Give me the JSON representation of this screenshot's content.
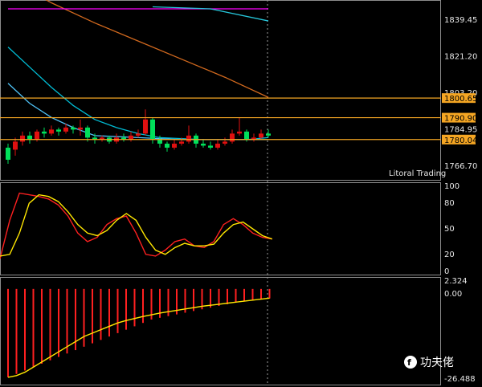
{
  "price_panel": {
    "axis_labels": [
      "1839.45",
      "1821.20",
      "1803.20",
      "1784.95",
      "1766.70"
    ],
    "axis_values": [
      1839.45,
      1821.2,
      1803.2,
      1784.95,
      1766.7
    ],
    "brand": "Litoral Trading",
    "levels": [
      {
        "label": "1800.65",
        "value": 1800.65,
        "color": "#f5a623"
      },
      {
        "label": "1790.90",
        "value": 1790.9,
        "color": "#f5a623"
      },
      {
        "label": "1780.04",
        "value": 1780.04,
        "color": "#f5a623"
      }
    ],
    "candles": [
      [
        1776,
        1770,
        1778,
        1768
      ],
      [
        1775,
        1779,
        1781,
        1772
      ],
      [
        1779,
        1782,
        1784,
        1777
      ],
      [
        1782,
        1780,
        1784,
        1778
      ],
      [
        1780,
        1784,
        1785,
        1779
      ],
      [
        1784,
        1783,
        1786,
        1781
      ],
      [
        1783,
        1785,
        1787,
        1782
      ],
      [
        1785,
        1784,
        1786,
        1782
      ],
      [
        1784,
        1786,
        1788,
        1783
      ],
      [
        1786,
        1785,
        1787,
        1783
      ],
      [
        1785,
        1786,
        1790,
        1782
      ],
      [
        1786,
        1781,
        1787,
        1779
      ],
      [
        1781,
        1780,
        1783,
        1778
      ],
      [
        1780,
        1781,
        1782,
        1779
      ],
      [
        1781,
        1779,
        1782,
        1778
      ],
      [
        1779,
        1781,
        1783,
        1778
      ],
      [
        1781,
        1780,
        1783,
        1779
      ],
      [
        1780,
        1782,
        1784,
        1779
      ],
      [
        1782,
        1783,
        1785,
        1781
      ],
      [
        1783,
        1790,
        1795,
        1782
      ],
      [
        1790,
        1780,
        1791,
        1778
      ],
      [
        1780,
        1778,
        1782,
        1776
      ],
      [
        1778,
        1776,
        1779,
        1774
      ],
      [
        1776,
        1778,
        1780,
        1775
      ],
      [
        1778,
        1779,
        1781,
        1777
      ],
      [
        1779,
        1782,
        1787,
        1778
      ],
      [
        1782,
        1778,
        1783,
        1776
      ],
      [
        1778,
        1777,
        1780,
        1776
      ],
      [
        1777,
        1776,
        1779,
        1775
      ],
      [
        1776,
        1778,
        1780,
        1775
      ],
      [
        1778,
        1779,
        1781,
        1777
      ],
      [
        1779,
        1783,
        1785,
        1778
      ],
      [
        1783,
        1784,
        1791,
        1782
      ],
      [
        1784,
        1780,
        1785,
        1779
      ],
      [
        1780,
        1781,
        1783,
        1779
      ],
      [
        1781,
        1783,
        1785,
        1780
      ],
      [
        1783,
        1782,
        1785,
        1781
      ]
    ],
    "candle_colors": {
      "up": "#e01010",
      "down": "#00e05a"
    },
    "moving_averages": [
      {
        "color": "#d2691e",
        "points": [
          [
            0,
            1860
          ],
          [
            6,
            1848
          ],
          [
            12,
            1838
          ],
          [
            18,
            1829
          ],
          [
            24,
            1820
          ],
          [
            30,
            1811
          ],
          [
            36,
            1801
          ]
        ]
      },
      {
        "color": "#00bcd4",
        "points": [
          [
            0,
            1826
          ],
          [
            3,
            1816
          ],
          [
            6,
            1806
          ],
          [
            9,
            1797
          ],
          [
            12,
            1790
          ],
          [
            15,
            1786
          ],
          [
            18,
            1783
          ],
          [
            21,
            1781
          ],
          [
            27,
            1780
          ],
          [
            33,
            1780
          ],
          [
            36,
            1781
          ]
        ]
      },
      {
        "color": "#4fc3f7",
        "points": [
          [
            0,
            1808
          ],
          [
            3,
            1798
          ],
          [
            6,
            1791
          ],
          [
            9,
            1786
          ],
          [
            12,
            1782
          ],
          [
            18,
            1781
          ],
          [
            24,
            1780
          ],
          [
            30,
            1780
          ],
          [
            36,
            1780
          ]
        ]
      },
      {
        "color": "#ff00ff",
        "points": [
          [
            0,
            1845
          ],
          [
            18,
            1845
          ],
          [
            36,
            1845
          ]
        ]
      },
      {
        "color": "#26c6da",
        "points": [
          [
            20,
            1846
          ],
          [
            28,
            1845
          ],
          [
            36,
            1839
          ]
        ]
      }
    ]
  },
  "stoch_panel": {
    "axis_labels": [
      "100",
      "80",
      "50",
      "20",
      "0"
    ],
    "axis_values": [
      100,
      80,
      50,
      20,
      0
    ],
    "main_line": {
      "color": "#ff2020",
      "values": [
        15,
        60,
        92,
        90,
        88,
        85,
        78,
        65,
        45,
        35,
        40,
        55,
        62,
        65,
        45,
        20,
        18,
        25,
        35,
        38,
        30,
        28,
        35,
        55,
        62,
        55,
        45,
        40,
        38
      ]
    },
    "signal_line": {
      "color": "#ffe600",
      "values": [
        18,
        20,
        45,
        80,
        90,
        88,
        82,
        70,
        55,
        45,
        42,
        48,
        60,
        68,
        60,
        40,
        25,
        20,
        28,
        33,
        30,
        30,
        32,
        45,
        55,
        58,
        50,
        42,
        38
      ]
    }
  },
  "macd_panel": {
    "axis_labels": [
      "2.324",
      "0.00",
      "-26.488"
    ],
    "axis_values": [
      2.324,
      0,
      -26.488
    ],
    "histogram": [
      -26,
      -25,
      -24,
      -23,
      -22,
      -21,
      -20,
      -19,
      -18,
      -17,
      -16,
      -15,
      -14,
      -13,
      -12,
      -11,
      -10,
      -9,
      -8.5,
      -8,
      -7.5,
      -7,
      -6.5,
      -6,
      -5.5,
      -5,
      -4.5,
      -4,
      -3.5,
      -3.2,
      -3,
      -2.8
    ],
    "histogram_color": "#ff2020",
    "signal": {
      "color": "#ffe600",
      "values": [
        -26,
        -25.5,
        -24.5,
        -23,
        -21.5,
        -20,
        -18.5,
        -17,
        -15.5,
        -14,
        -13,
        -12,
        -11,
        -10,
        -9.3,
        -8.7,
        -8.1,
        -7.6,
        -7.1,
        -6.7,
        -6.3,
        -5.9,
        -5.5,
        -5.1,
        -4.8,
        -4.5,
        -4.2,
        -3.9,
        -3.6,
        -3.3,
        -3.0,
        -2.7
      ]
    }
  },
  "watermark": {
    "text": "功夫佬",
    "icon": "kungfu-logo-icon"
  }
}
